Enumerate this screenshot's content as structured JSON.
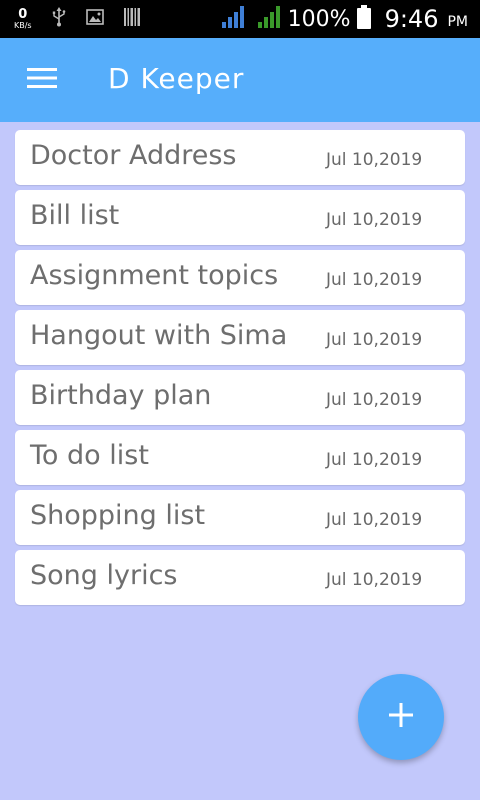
{
  "status_bar": {
    "data_speed": "0",
    "data_unit": "KB/s",
    "icons": [
      "usb-icon",
      "image-icon",
      "barcode-icon",
      "signal-icon-1",
      "signal-icon-2",
      "battery-icon"
    ],
    "battery": "100%",
    "time": "9:46",
    "ampm": "PM"
  },
  "app_bar": {
    "title": "D Keeper",
    "menu_icon": "hamburger-menu-icon",
    "color": "#56aefb"
  },
  "notes": [
    {
      "title": "Doctor Address",
      "date": "Jul 10,2019"
    },
    {
      "title": "Bill list",
      "date": "Jul 10,2019"
    },
    {
      "title": "Assignment topics",
      "date": "Jul 10,2019"
    },
    {
      "title": "Hangout with Sima",
      "date": "Jul 10,2019"
    },
    {
      "title": "Birthday plan",
      "date": "Jul 10,2019"
    },
    {
      "title": "To do list",
      "date": "Jul 10,2019"
    },
    {
      "title": "Shopping list",
      "date": "Jul 10,2019"
    },
    {
      "title": "Song lyrics",
      "date": "Jul 10,2019"
    }
  ],
  "fab": {
    "icon": "plus-icon",
    "color": "#53abfa"
  },
  "colors": {
    "background": "#c2c8fb",
    "status_bar": "#000000",
    "signal": "#3a9a2a"
  }
}
